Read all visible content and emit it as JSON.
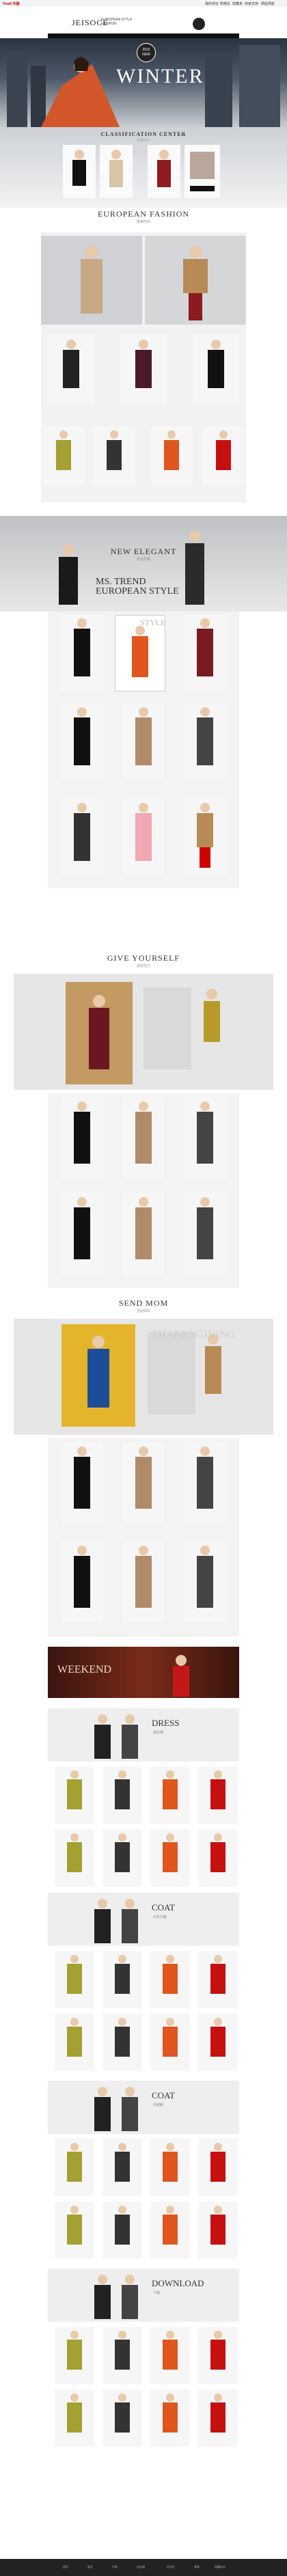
{
  "topbar": {
    "brand_left": "Tmall 天猫",
    "links": [
      "我的淘宝",
      "购物车",
      "收藏夹",
      "商家支持",
      "网站导航"
    ]
  },
  "header": {
    "logo": "JEISOCE",
    "tagline_line1": "EUROPEAN STYLE",
    "tagline_line2": "FASHION"
  },
  "hero": {
    "title": "WINTER",
    "badge_top": "2015",
    "badge_bottom": "NEW"
  },
  "classification": {
    "title": "CLASSIFICATION CENTER",
    "subtitle": "分类中心"
  },
  "european": {
    "title": "EUROPEAN FASHION",
    "subtitle": "欧美时尚"
  },
  "new_elegant": {
    "title": "NEW ELEGANT",
    "subtitle": "新品优雅"
  },
  "ms_trend": {
    "line1": "MS. TREND",
    "line2": "EUROPEAN STYLE"
  },
  "style_box": "STYLE",
  "give_yourself": {
    "title": "GIVE YOURSELF",
    "subtitle": "送给自己"
  },
  "send_mom": {
    "title": "SEND MOM",
    "subtitle": "送给妈妈"
  },
  "thanksgiving": "THANKSGIVING",
  "weekend": "WEEKEND",
  "categories": [
    {
      "label": "DRESS",
      "sub": "连衣裙"
    },
    {
      "label": "COAT",
      "sub": "大衣外套"
    },
    {
      "label": "COAT",
      "sub": "羽绒服"
    },
    {
      "label": "DOWNLOAD",
      "sub": "下装"
    }
  ],
  "footer_links": [
    "首页",
    "新品",
    "外套",
    "连衣裙",
    "针织衫",
    "裤装",
    "收藏本店"
  ]
}
